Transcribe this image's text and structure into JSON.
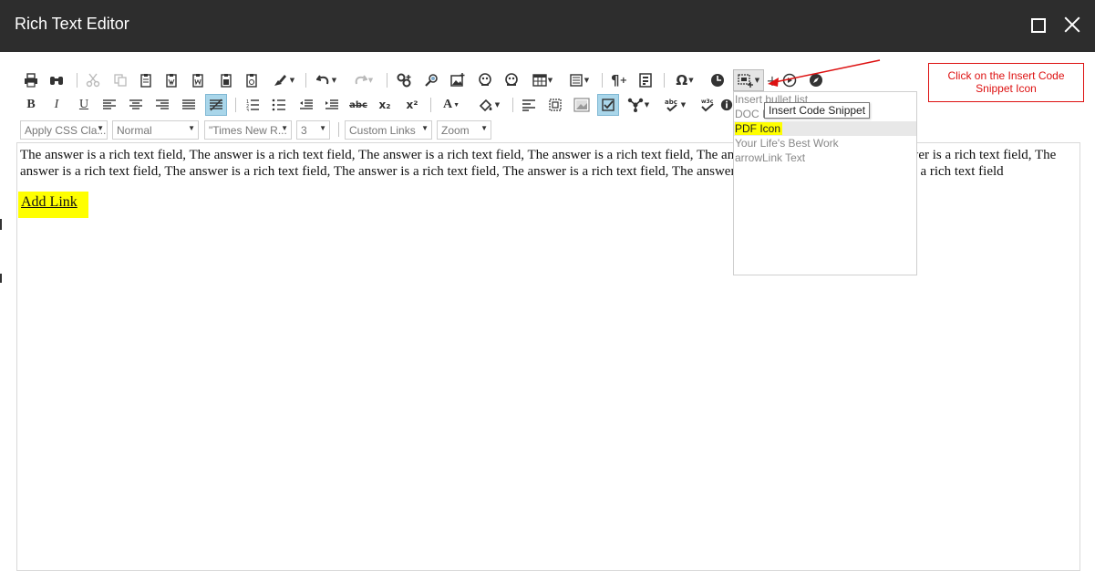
{
  "window": {
    "title": "Rich Text Editor"
  },
  "toolbar_row1": [
    {
      "name": "print-icon",
      "glyph": "🖶"
    },
    {
      "name": "find-icon",
      "glyph": "🔭"
    },
    {
      "name": "cut-icon",
      "glyph": "✂"
    },
    {
      "name": "copy-icon",
      "glyph": "⧉"
    },
    {
      "name": "paste-icon",
      "glyph": "📋"
    },
    {
      "name": "paste-plain-icon",
      "glyph": "📋"
    },
    {
      "name": "paste-word-icon",
      "glyph": "📋"
    },
    {
      "name": "paste-html-icon",
      "glyph": "📋"
    },
    {
      "name": "paste-markdown-icon",
      "glyph": "📋"
    },
    {
      "name": "format-painter-icon",
      "glyph": "🖌"
    },
    {
      "name": "undo-icon",
      "glyph": "↶"
    },
    {
      "name": "redo-icon",
      "glyph": "↷"
    },
    {
      "name": "hyperlink-icon",
      "glyph": "🔗"
    },
    {
      "name": "remove-link-icon",
      "glyph": "🔍"
    },
    {
      "name": "image-icon",
      "glyph": "🖼"
    },
    {
      "name": "media-icon",
      "glyph": "⚙"
    },
    {
      "name": "flash-icon",
      "glyph": "⚙"
    },
    {
      "name": "table-icon",
      "glyph": "▦"
    },
    {
      "name": "template-icon",
      "glyph": "▤"
    },
    {
      "name": "paragraph-icon",
      "glyph": "¶"
    },
    {
      "name": "form-icon",
      "glyph": "▣"
    },
    {
      "name": "symbol-icon",
      "glyph": "Ω"
    },
    {
      "name": "time-icon",
      "glyph": "◔"
    },
    {
      "name": "insert-code-snippet-icon",
      "glyph": "⊡"
    },
    {
      "name": "add-icon",
      "glyph": "+"
    },
    {
      "name": "module-icon",
      "glyph": "◉"
    },
    {
      "name": "compass-icon",
      "glyph": "✪"
    }
  ],
  "toolbar_row2": [
    {
      "name": "bold-button",
      "glyph": "B"
    },
    {
      "name": "italic-button",
      "glyph": "I"
    },
    {
      "name": "underline-button",
      "glyph": "U"
    },
    {
      "name": "align-left-icon",
      "glyph": "≡"
    },
    {
      "name": "align-center-icon",
      "glyph": "≡"
    },
    {
      "name": "align-right-icon",
      "glyph": "≡"
    },
    {
      "name": "justify-icon",
      "glyph": "≡"
    },
    {
      "name": "strike-block-icon",
      "glyph": "≡"
    },
    {
      "name": "numbered-list-icon",
      "glyph": "⒈"
    },
    {
      "name": "bullet-list-icon",
      "glyph": "•"
    },
    {
      "name": "outdent-icon",
      "glyph": "⇤"
    },
    {
      "name": "indent-icon",
      "glyph": "⇥"
    },
    {
      "name": "strikethrough-icon",
      "glyph": "abc"
    },
    {
      "name": "subscript-icon",
      "glyph": "x₂"
    },
    {
      "name": "superscript-icon",
      "glyph": "x²"
    },
    {
      "name": "font-color-icon",
      "glyph": "A"
    },
    {
      "name": "highlight-icon",
      "glyph": "✎"
    },
    {
      "name": "paragraph-style-icon",
      "glyph": "≣"
    },
    {
      "name": "show-blocks-icon",
      "glyph": "▢"
    },
    {
      "name": "image-manager-icon",
      "glyph": "▨"
    },
    {
      "name": "track-changes-icon",
      "glyph": "☑"
    },
    {
      "name": "share-icon",
      "glyph": "✣"
    },
    {
      "name": "spellcheck-icon",
      "glyph": "✔"
    },
    {
      "name": "accessibility-check-icon",
      "glyph": "✔"
    },
    {
      "name": "info-icon",
      "glyph": "ℹ"
    }
  ],
  "row3": {
    "css_class": "Apply CSS Cla...",
    "paragraph": "Normal",
    "font": "\"Times New R...",
    "size": "3",
    "links": "Custom Links",
    "zoom": "Zoom"
  },
  "editor": {
    "paragraph": "The answer is a rich text field, The answer is a rich text field, The answer is a rich text field, The answer is a rich text field, The answer is a rich text field, The answer is a rich text field, The answer is a rich text field, The answer is a rich text field, The answer is a rich text field, The answer is a rich text field, The answer is a rich text field, The answer is a rich text field",
    "link_text": "Add Link"
  },
  "snippet_menu": {
    "items": [
      "Insert bullet list",
      "DOC Icon",
      "PDF Icon",
      "Your Life's Best Work",
      "arrowLink Text"
    ],
    "hovered_index": 2
  },
  "tooltip": "Insert Code Snippet",
  "callout": "Click on the Insert Code Snippet Icon",
  "colors": {
    "titlebar": "#2d2d2d",
    "highlight": "#ffff00",
    "annotation": "#dd1111",
    "active_button": "#a9d6ea"
  }
}
